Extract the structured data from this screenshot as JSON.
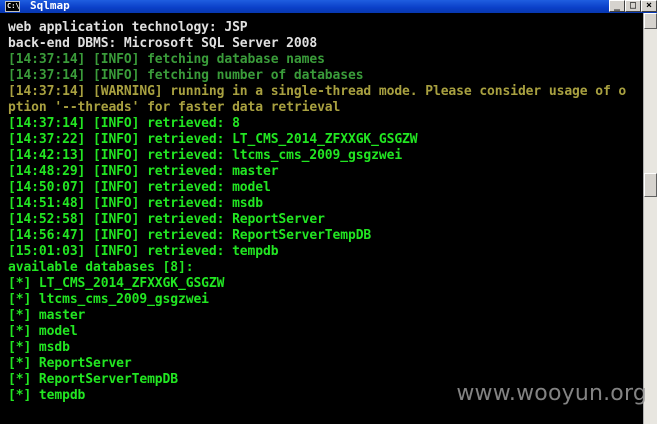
{
  "window": {
    "title": "Sqlmap",
    "icon_text": "C:\\",
    "minimize_label": "_",
    "maximize_label": "□",
    "close_label": "×"
  },
  "console": {
    "lines": [
      "web application technology: JSP",
      "back-end DBMS: Microsoft SQL Server 2008",
      "[14:37:14] [INFO] fetching database names",
      "[14:37:14] [INFO] fetching number of databases",
      "[14:37:14] [WARNING] running in a single-thread mode. Please consider usage of o",
      "ption '--threads' for faster data retrieval",
      "[14:37:14] [INFO] retrieved: 8",
      "[14:37:22] [INFO] retrieved: LT_CMS_2014_ZFXXGK_GSGZW",
      "[14:42:13] [INFO] retrieved: ltcms_cms_2009_gsgzwei",
      "[14:48:29] [INFO] retrieved: master",
      "[14:50:07] [INFO] retrieved: model",
      "[14:51:48] [INFO] retrieved: msdb",
      "[14:52:58] [INFO] retrieved: ReportServer",
      "[14:56:47] [INFO] retrieved: ReportServerTempDB",
      "[15:01:03] [INFO] retrieved: tempdb",
      "available databases [8]:",
      "[*] LT_CMS_2014_ZFXXGK_GSGZW",
      "[*] ltcms_cms_2009_gsgzwei",
      "[*] master",
      "[*] model",
      "[*] msdb",
      "[*] ReportServer",
      "[*] ReportServerTempDB",
      "[*] tempdb"
    ]
  },
  "watermark": "www.wooyun.org",
  "colors": {
    "title_bar": "#0a3fc8",
    "console_bg": "#000000",
    "text_white": "#e0e0e0",
    "text_dark_green": "#3a9c3a",
    "text_green": "#22e622",
    "text_warning": "#a8a040"
  }
}
